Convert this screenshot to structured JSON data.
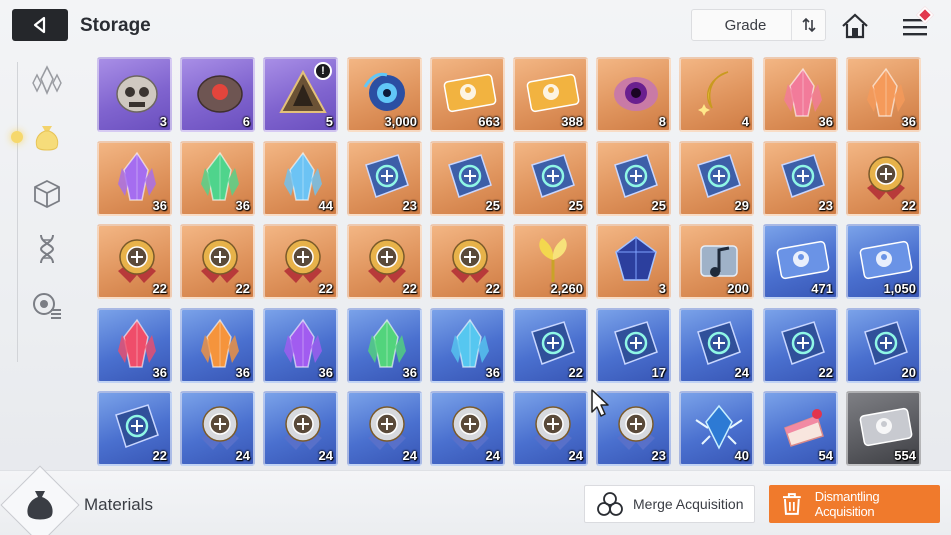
{
  "header": {
    "back_icon": "back-triangle-icon",
    "title": "Storage",
    "grade_label": "Grade",
    "sort_icon": "sort-arrows-icon",
    "home_icon": "home-icon",
    "menu_icon": "hamburger-menu-icon"
  },
  "sidebar": {
    "active_index": 1,
    "items": [
      {
        "name": "crystal-category",
        "icon": "crystal-icon"
      },
      {
        "name": "materials-category",
        "icon": "bag-icon"
      },
      {
        "name": "cube-category",
        "icon": "cube-icon"
      },
      {
        "name": "dna-category",
        "icon": "dna-icon"
      },
      {
        "name": "sensor-category",
        "icon": "sensor-icon"
      }
    ]
  },
  "grid": {
    "rows": [
      [
        {
          "item": "skull-rock",
          "rarity": "purple",
          "count": "3"
        },
        {
          "item": "red-core-rock",
          "rarity": "purple",
          "count": "6"
        },
        {
          "item": "pyramid-relic",
          "rarity": "purple",
          "count": "5",
          "badge": "!"
        },
        {
          "item": "blue-orb",
          "rarity": "orange",
          "count": "3,000"
        },
        {
          "item": "gold-card",
          "rarity": "orange",
          "count": "663"
        },
        {
          "item": "gold-ticket",
          "rarity": "orange",
          "count": "388"
        },
        {
          "item": "purple-eye",
          "rarity": "orange",
          "count": "8"
        },
        {
          "item": "gold-crescent",
          "rarity": "orange",
          "count": "4"
        },
        {
          "item": "pink-crystal",
          "rarity": "orange",
          "count": "36"
        },
        {
          "item": "orange-crystal",
          "rarity": "orange",
          "count": "36"
        }
      ],
      [
        {
          "item": "purple-crystal",
          "rarity": "orange",
          "count": "36"
        },
        {
          "item": "green-crystal",
          "rarity": "orange",
          "count": "36"
        },
        {
          "item": "blue-crystal",
          "rarity": "orange",
          "count": "44"
        },
        {
          "item": "book-swords",
          "rarity": "orange",
          "count": "23"
        },
        {
          "item": "book-shield",
          "rarity": "orange",
          "count": "25"
        },
        {
          "item": "book-target",
          "rarity": "orange",
          "count": "25"
        },
        {
          "item": "book-cross",
          "rarity": "orange",
          "count": "25"
        },
        {
          "item": "book-bolt",
          "rarity": "orange",
          "count": "29"
        },
        {
          "item": "book-circle",
          "rarity": "orange",
          "count": "23"
        },
        {
          "item": "medal-plus",
          "rarity": "orange",
          "count": "22"
        }
      ],
      [
        {
          "item": "medal-shield",
          "rarity": "orange",
          "count": "22"
        },
        {
          "item": "medal-target",
          "rarity": "orange",
          "count": "22"
        },
        {
          "item": "medal-cross",
          "rarity": "orange",
          "count": "22"
        },
        {
          "item": "medal-bolt",
          "rarity": "orange",
          "count": "22"
        },
        {
          "item": "medal-circle",
          "rarity": "orange",
          "count": "22"
        },
        {
          "item": "gold-sprout",
          "rarity": "orange",
          "count": "2,260"
        },
        {
          "item": "blue-gem",
          "rarity": "orange",
          "count": "3"
        },
        {
          "item": "music-scroll",
          "rarity": "orange",
          "count": "200"
        },
        {
          "item": "blue-card",
          "rarity": "blue",
          "count": "471"
        },
        {
          "item": "blue-ticket",
          "rarity": "blue",
          "count": "1,050"
        }
      ],
      [
        {
          "item": "red-shard",
          "rarity": "blue",
          "count": "36"
        },
        {
          "item": "orange-shard",
          "rarity": "blue",
          "count": "36"
        },
        {
          "item": "purple-shard",
          "rarity": "blue",
          "count": "36"
        },
        {
          "item": "green-shard",
          "rarity": "blue",
          "count": "36"
        },
        {
          "item": "cyan-shard",
          "rarity": "blue",
          "count": "36"
        },
        {
          "item": "blue-book-swords",
          "rarity": "blue",
          "count": "22"
        },
        {
          "item": "blue-book-shield",
          "rarity": "blue",
          "count": "17"
        },
        {
          "item": "blue-book-target",
          "rarity": "blue",
          "count": "24"
        },
        {
          "item": "blue-book-cross",
          "rarity": "blue",
          "count": "22"
        },
        {
          "item": "blue-book-bolt",
          "rarity": "blue",
          "count": "20"
        }
      ],
      [
        {
          "item": "blue-book-circle",
          "rarity": "blue",
          "count": "22"
        },
        {
          "item": "silver-medal-plus",
          "rarity": "blue",
          "count": "24"
        },
        {
          "item": "silver-medal-shield",
          "rarity": "blue",
          "count": "24"
        },
        {
          "item": "silver-medal-target",
          "rarity": "blue",
          "count": "24"
        },
        {
          "item": "silver-medal-cross",
          "rarity": "blue",
          "count": "24"
        },
        {
          "item": "silver-medal-bolt",
          "rarity": "blue",
          "count": "24"
        },
        {
          "item": "silver-medal-circle",
          "rarity": "blue",
          "count": "23"
        },
        {
          "item": "frost-orb",
          "rarity": "blue",
          "count": "40"
        },
        {
          "item": "strawberry-cake",
          "rarity": "blue",
          "count": "54"
        },
        {
          "item": "silver-card",
          "rarity": "gray",
          "count": "554"
        }
      ]
    ]
  },
  "footer": {
    "category_icon": "bag-icon",
    "category_label": "Materials",
    "merge_label": "Merge Acquisition",
    "merge_icon": "merge-circles-icon",
    "dismantle_label": "Dismantling Acquisition",
    "dismantle_icon": "trash-icon"
  },
  "colors": {
    "accent_orange": "#f07a2c",
    "rarity_purple": "#8064cf",
    "rarity_orange": "#e0955e",
    "rarity_blue": "#4a70cf",
    "rarity_gray": "#58595e",
    "badge_red": "#e2384d"
  }
}
